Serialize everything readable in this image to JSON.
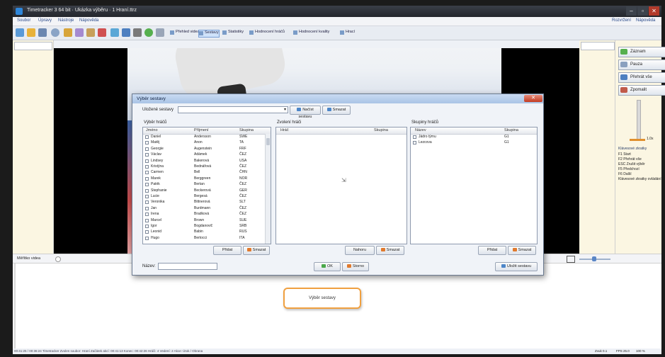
{
  "window": {
    "title": "Timetracker 3 64 bit · Ukázka výběru · 1 Hraní.ttrz",
    "min": "–",
    "max": "▫",
    "close": "✕"
  },
  "menu": {
    "items": [
      "Soubor",
      "Úpravy",
      "Nástroje",
      "Nápověda"
    ],
    "right": [
      "Rozvržení",
      "Nápověda"
    ]
  },
  "toolbar": {
    "tabs": [
      "Přehled videa",
      "Sestavy",
      "Statistiky",
      "Hodnocení hráčů",
      "Hodnocení kvality",
      "Hrací"
    ]
  },
  "right_panel": {
    "buttons": [
      "Záznam",
      "Pauza",
      "Přehrát vše",
      "Zpomalit"
    ],
    "speed_value": "1.0x",
    "legend_title": "Klávesové zkratky",
    "legend_items": [
      "F1 Start",
      "F2 Přehrát vše",
      "ESC Zrušit výběr",
      "F5 Předchozí",
      "F6 Další"
    ],
    "legend_tail": "Klávesové zkratky ovládání"
  },
  "bottom": {
    "zoom_label": "Měřítko videa",
    "node_label": "Výběr sestavy",
    "status": "00:41:25 / 00:36:24   Timetracker   Zvolen soubor: Hraní   Začátek akcí: 00:41:13   Konec: 00:42:26   Hráči: 4   Vedení: 2   Akce: Útok / Obrana",
    "status_right": [
      "Zvuk 0.1",
      "FPS 25.0",
      "100 %"
    ]
  },
  "dialog": {
    "title": "Výběr sestavy",
    "saved_label": "Uložené sestavy",
    "saved_value": "",
    "btn_load": "Načíst sestavu",
    "btn_delete": "Smazat",
    "players": {
      "title": "Výběr hráčů",
      "columns": [
        "Jméno",
        "Příjmení",
        "Skupina"
      ],
      "rows": [
        [
          "Daniel",
          "Andersson",
          "SWE"
        ],
        [
          "Matěj",
          "Anon",
          "TA"
        ],
        [
          "Georgie",
          "Augenstein",
          "FRF"
        ],
        [
          "Václav",
          "Adámek",
          "ČEZ"
        ],
        [
          "Lindsey",
          "Bakerová",
          "USA"
        ],
        [
          "Kristýna",
          "Bednářová",
          "ČEZ"
        ],
        [
          "Carmen",
          "Bell",
          "ČHN"
        ],
        [
          "Marek",
          "Berggreen",
          "NOR"
        ],
        [
          "Patrik",
          "Bertan",
          "ČEZ"
        ],
        [
          "Stephanie",
          "Beckerová",
          "GER"
        ],
        [
          "Lucie",
          "Bergesá",
          "ČEZ"
        ],
        [
          "Veronika",
          "Bittnerová",
          "SLT"
        ],
        [
          "Jan",
          "Burdmann",
          "ČEZ"
        ],
        [
          "Irena",
          "Bradková",
          "ČEZ"
        ],
        [
          "Marcel",
          "Brown",
          "SUE"
        ],
        [
          "Igor",
          "Bogdanovič",
          "SRB"
        ],
        [
          "Leonid",
          "Babin",
          "RUS"
        ],
        [
          "Hugo",
          "Bertocci",
          "ITA"
        ]
      ],
      "btn_add": "Přidat",
      "btn_remove": "Smazat"
    },
    "selected": {
      "title": "Zvolení hráči",
      "columns": [
        "Hráč",
        "Skupina"
      ],
      "btn_up": "Nahoru",
      "btn_remove": "Smazat"
    },
    "groups": {
      "title": "Skupiny hráčů",
      "columns": [
        "Název",
        "Skupina"
      ],
      "rows": [
        [
          "Jádro týmu",
          "G1"
        ],
        [
          "Lezcova",
          "G1"
        ]
      ],
      "btn_add": "Přidat",
      "btn_remove": "Smazat"
    },
    "name_label": "Název:",
    "name_value": "",
    "btn_ok": "OK",
    "btn_cancel": "Storno",
    "btn_save": "Uložit sestavu"
  },
  "colors": {
    "accent": "#f0a040",
    "title_blue": "#a9c4e6",
    "panel_cream": "#fbf6e2"
  }
}
